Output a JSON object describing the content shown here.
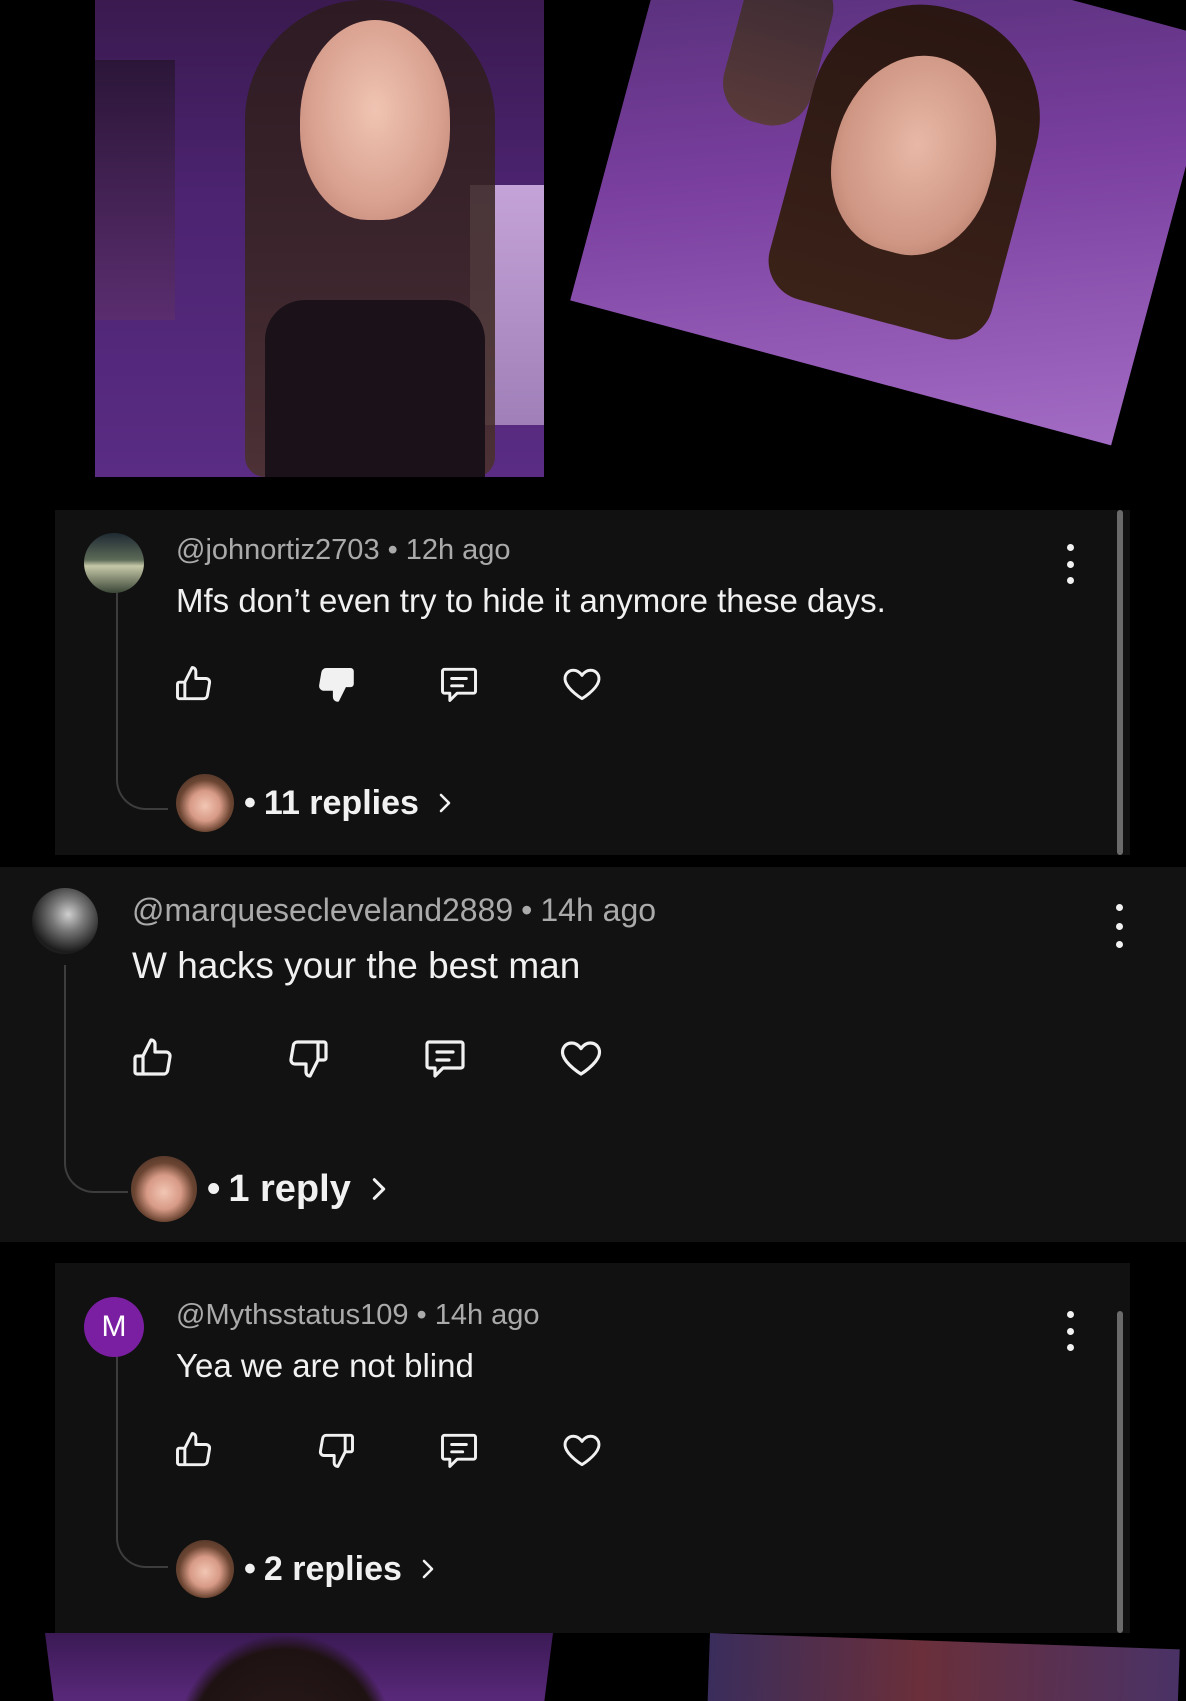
{
  "theme": {
    "background": "#000000",
    "card_background": "#111111",
    "text_primary": "#f1f1f1",
    "text_secondary": "#aaaaaa",
    "avatar_letter_color": "#7b1fa2"
  },
  "comments": [
    {
      "username": "@johnortiz2703",
      "time": "12h ago",
      "text": "Mfs don’t even try to hide it anymore these days.",
      "replies_label": "11 replies",
      "dislike_filled": true
    },
    {
      "username": "@marquesecleveland2889",
      "time": "14h ago",
      "text": "W hacks your the best man",
      "replies_label": "1 reply",
      "dislike_filled": false
    },
    {
      "username": "@Mythsstatus109",
      "time": "14h ago",
      "text": "Yea we are not blind",
      "replies_label": "2 replies",
      "avatar_letter": "M",
      "dislike_filled": false
    }
  ],
  "separators": {
    "meta_dot": "•",
    "reply_dot": "•"
  },
  "icons": {
    "like": "thumbs-up-icon",
    "dislike": "thumbs-down-icon",
    "reply": "comment-icon",
    "heart": "heart-icon",
    "more": "more-vert-icon",
    "chevron": "chevron-right-icon"
  }
}
